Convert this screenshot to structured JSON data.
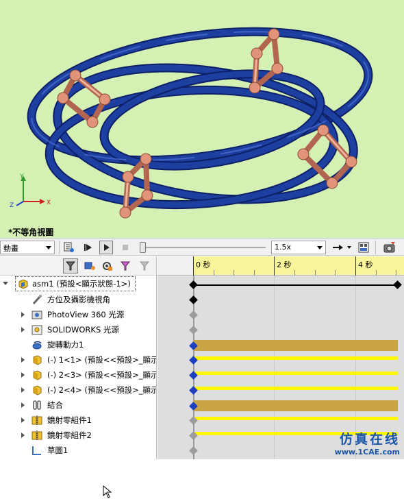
{
  "viewport": {
    "view_label": "*不等角視圖",
    "triad": {
      "x": "X",
      "y": "Y",
      "z": "Z"
    },
    "colors": {
      "background": "#d4f1b3",
      "rings": "#1c3fa0",
      "connectors": "#e2947a"
    }
  },
  "toolbar": {
    "study_type": "動畫",
    "speed": "1.5x",
    "icons": [
      "calculate-icon",
      "play-from-start-icon",
      "play-icon",
      "stop-icon",
      "playback-mode-icon",
      "save-animation-icon",
      "animation-wizard-icon"
    ]
  },
  "tree": {
    "filter_icons": [
      "filter-icon",
      "autokey-icon",
      "add-key-icon",
      "filter-animated-icon",
      "filter-selected-icon"
    ],
    "items": [
      {
        "label": "asm1 (預設<顯示狀態-1>)",
        "icon": "assembly-icon",
        "expander": "down"
      },
      {
        "label": "方位及攝影機視角",
        "icon": "camera-icon",
        "expander": "none"
      },
      {
        "label": "PhotoView 360 光源",
        "icon": "photoview-icon",
        "expander": "right"
      },
      {
        "label": "SOLIDWORKS 光源",
        "icon": "lights-icon",
        "expander": "right"
      },
      {
        "label": "旋轉動力1",
        "icon": "rotary-motor-icon",
        "expander": "none"
      },
      {
        "label": "(-) 1<1> (預設<<預設>_顯示",
        "icon": "part-icon",
        "expander": "right"
      },
      {
        "label": "(-) 2<3> (預設<<預設>_顯示",
        "icon": "part-icon",
        "expander": "right"
      },
      {
        "label": "(-) 2<4> (預設<<預設>_顯示",
        "icon": "part-icon",
        "expander": "right"
      },
      {
        "label": "結合",
        "icon": "mates-icon",
        "expander": "right"
      },
      {
        "label": "鏡射零組件1",
        "icon": "mirror-component-icon",
        "expander": "right"
      },
      {
        "label": "鏡射零組件2",
        "icon": "mirror-component-icon",
        "expander": "right"
      },
      {
        "label": "草圖1",
        "icon": "sketch-icon",
        "expander": "none"
      }
    ]
  },
  "timeline": {
    "ticks": [
      "0 秒",
      "2 秒",
      "4 秒"
    ],
    "colors": {
      "ruler": "#f8f59a",
      "motor_bar": "#c9a546",
      "motion_bar": "#fff700",
      "key": "#1e3fbf"
    }
  },
  "watermark": {
    "cn": "仿真在线",
    "en": "www.1CAE.com"
  }
}
